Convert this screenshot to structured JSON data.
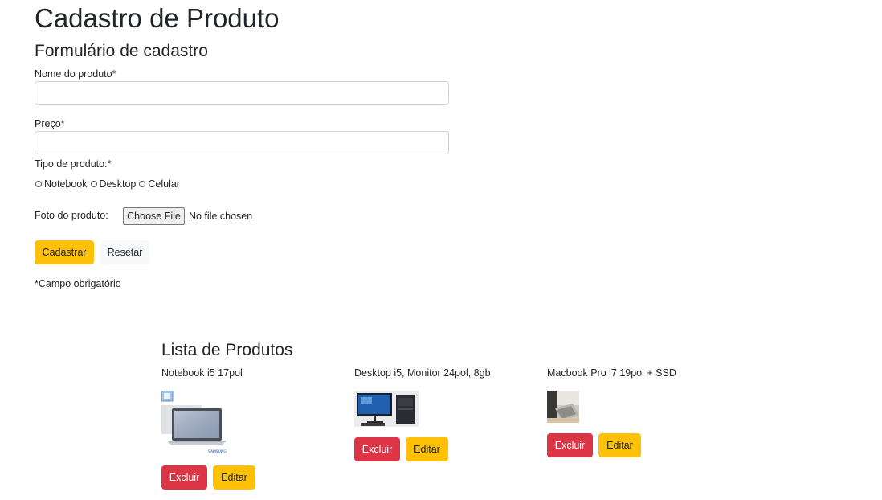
{
  "page": {
    "title": "Cadastro de Produto",
    "form_title": "Formulário de cadastro"
  },
  "form": {
    "name_label": "Nome do produto*",
    "name_value": "",
    "price_label": "Preço*",
    "price_value": "",
    "type_label": "Tipo de produto:*",
    "type_options": [
      "Notebook",
      "Desktop",
      "Celular"
    ],
    "photo_label": "Foto do produto:",
    "file_button": "Choose File",
    "file_status": "No file chosen",
    "submit_label": "Cadastrar",
    "reset_label": "Resetar",
    "required_note": "*Campo obrigatório"
  },
  "list": {
    "title": "Lista de Produtos",
    "products": [
      {
        "name": "Notebook i5 17pol",
        "delete_label": "Excluir",
        "edit_label": "Editar",
        "image_icon": "laptop-image",
        "brand_text": "SAMSUNG"
      },
      {
        "name": "Desktop i5, Monitor 24pol, 8gb",
        "delete_label": "Excluir",
        "edit_label": "Editar",
        "image_icon": "desktop-image"
      },
      {
        "name": "Macbook Pro i7 19pol + SSD",
        "delete_label": "Excluir",
        "edit_label": "Editar",
        "image_icon": "macbook-photo"
      }
    ]
  },
  "colors": {
    "warning": "#ffc107",
    "danger": "#dc3545",
    "light": "#f8f9fa",
    "text": "#212529"
  }
}
